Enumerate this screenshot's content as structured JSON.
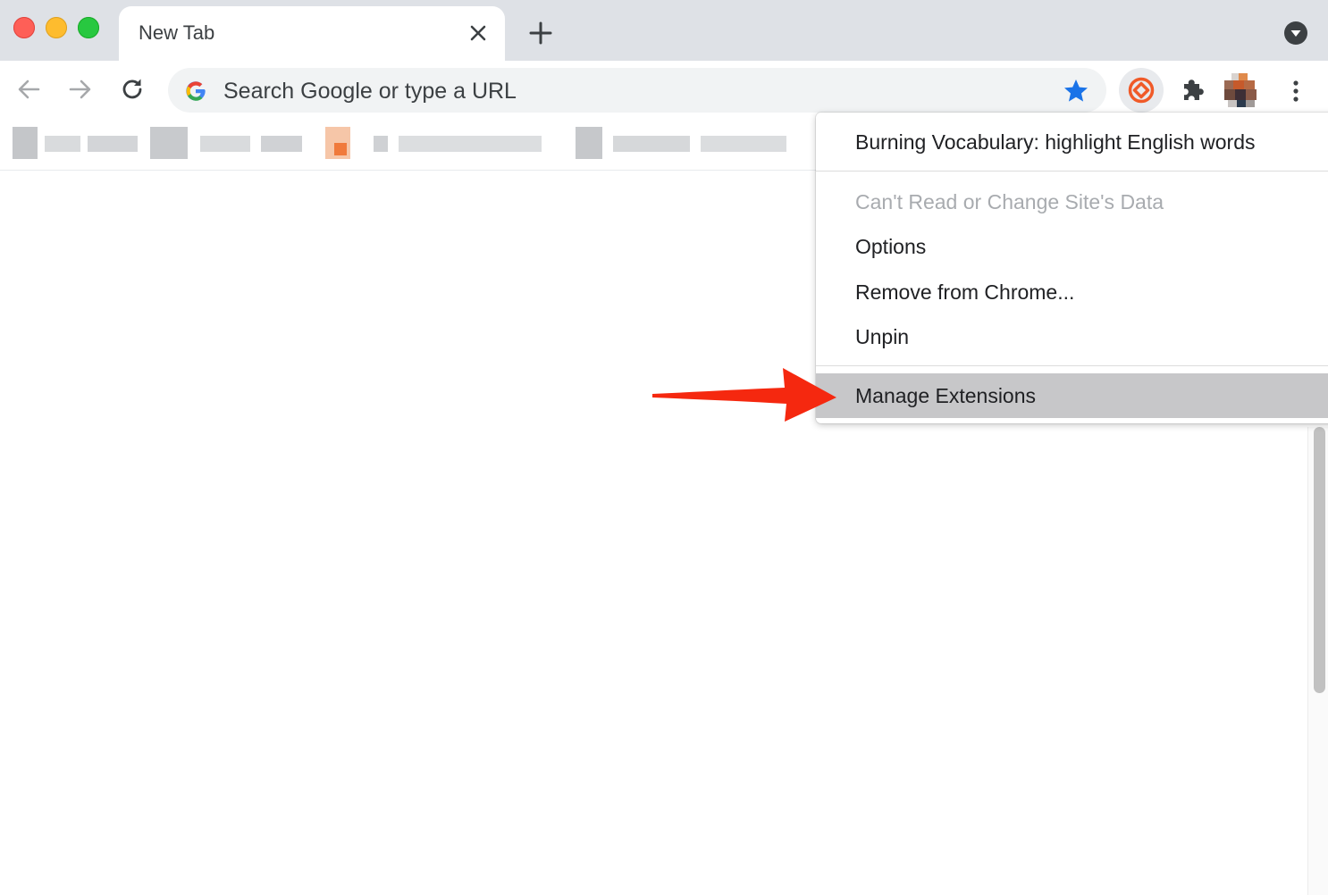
{
  "tab": {
    "title": "New Tab"
  },
  "omnibox": {
    "placeholder": "Search Google or type a URL"
  },
  "context_menu": {
    "header": "Burning Vocabulary: highlight English words",
    "permission": "Can't Read or Change Site's Data",
    "options": "Options",
    "remove": "Remove from Chrome...",
    "unpin": "Unpin",
    "manage": "Manage Extensions"
  },
  "colors": {
    "tab_strip": "#dee1e6",
    "star": "#1a73e8",
    "extension_accent": "#f05a28",
    "annotation_arrow": "#f5280f",
    "menu_highlight": "#c7c7c9"
  },
  "icons": {
    "close_window": "close-window-icon",
    "minimize_window": "minimize-window-icon",
    "maximize_window": "maximize-window-icon",
    "tab_close": "close-icon",
    "new_tab": "plus-icon",
    "tab_search": "chevron-down-icon",
    "back": "arrow-left-icon",
    "forward": "arrow-right-icon",
    "reload": "reload-icon",
    "google": "google-g-icon",
    "bookmark": "star-icon",
    "extension": "burning-vocabulary-icon",
    "extensions_menu": "puzzle-icon",
    "more": "more-vertical-icon"
  }
}
